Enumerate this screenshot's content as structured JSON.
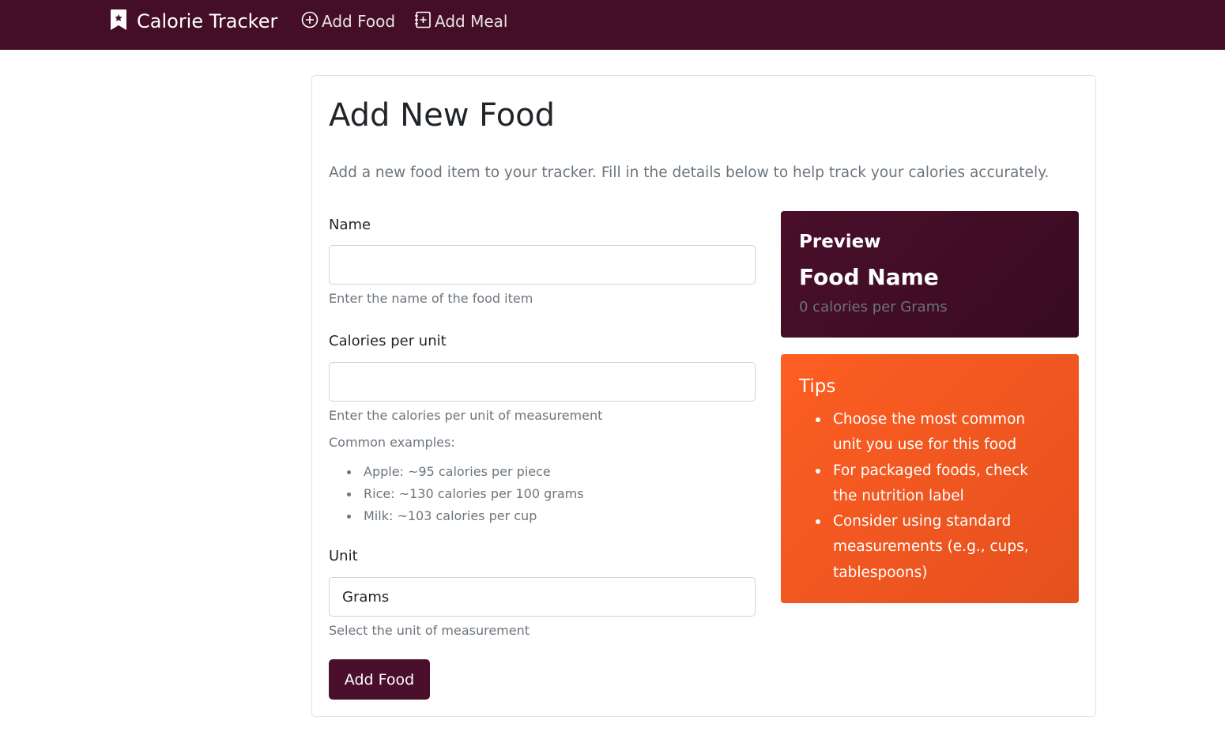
{
  "navbar": {
    "brand_text": "Calorie Tracker",
    "brand_icon": "bookmark-icon",
    "links": [
      {
        "label": "Add Food",
        "icon": "plus-circle-icon"
      },
      {
        "label": "Add Meal",
        "icon": "journal-plus-icon"
      }
    ],
    "background": "#440f26"
  },
  "page": {
    "title": "Add New Food",
    "lead": "Add a new food item to your tracker. Fill in the details below to help track your calories accurately."
  },
  "form": {
    "name": {
      "label": "Name",
      "value": "",
      "help": "Enter the name of the food item"
    },
    "calories": {
      "label": "Calories per unit",
      "value": "",
      "help": "Enter the calories per unit of measurement",
      "examples_title": "Common examples:",
      "examples": [
        "Apple: ~95 calories per piece",
        "Rice: ~130 calories per 100 grams",
        "Milk: ~103 calories per cup"
      ]
    },
    "unit": {
      "label": "Unit",
      "value": "Grams",
      "help": "Select the unit of measurement"
    },
    "submit_label": "Add Food"
  },
  "preview": {
    "title": "Preview",
    "food_name": "Food Name",
    "calories_text": "0 calories per Grams"
  },
  "tips": {
    "title": "Tips",
    "items": [
      "Choose the most common unit you use for this food",
      "For packaged foods, check the nutrition label",
      "Consider using standard measurements (e.g., cups, tablespoons)"
    ]
  },
  "colors": {
    "primary": "#4a0f2a",
    "accent": "#fd5e22",
    "muted": "#6c757d"
  }
}
